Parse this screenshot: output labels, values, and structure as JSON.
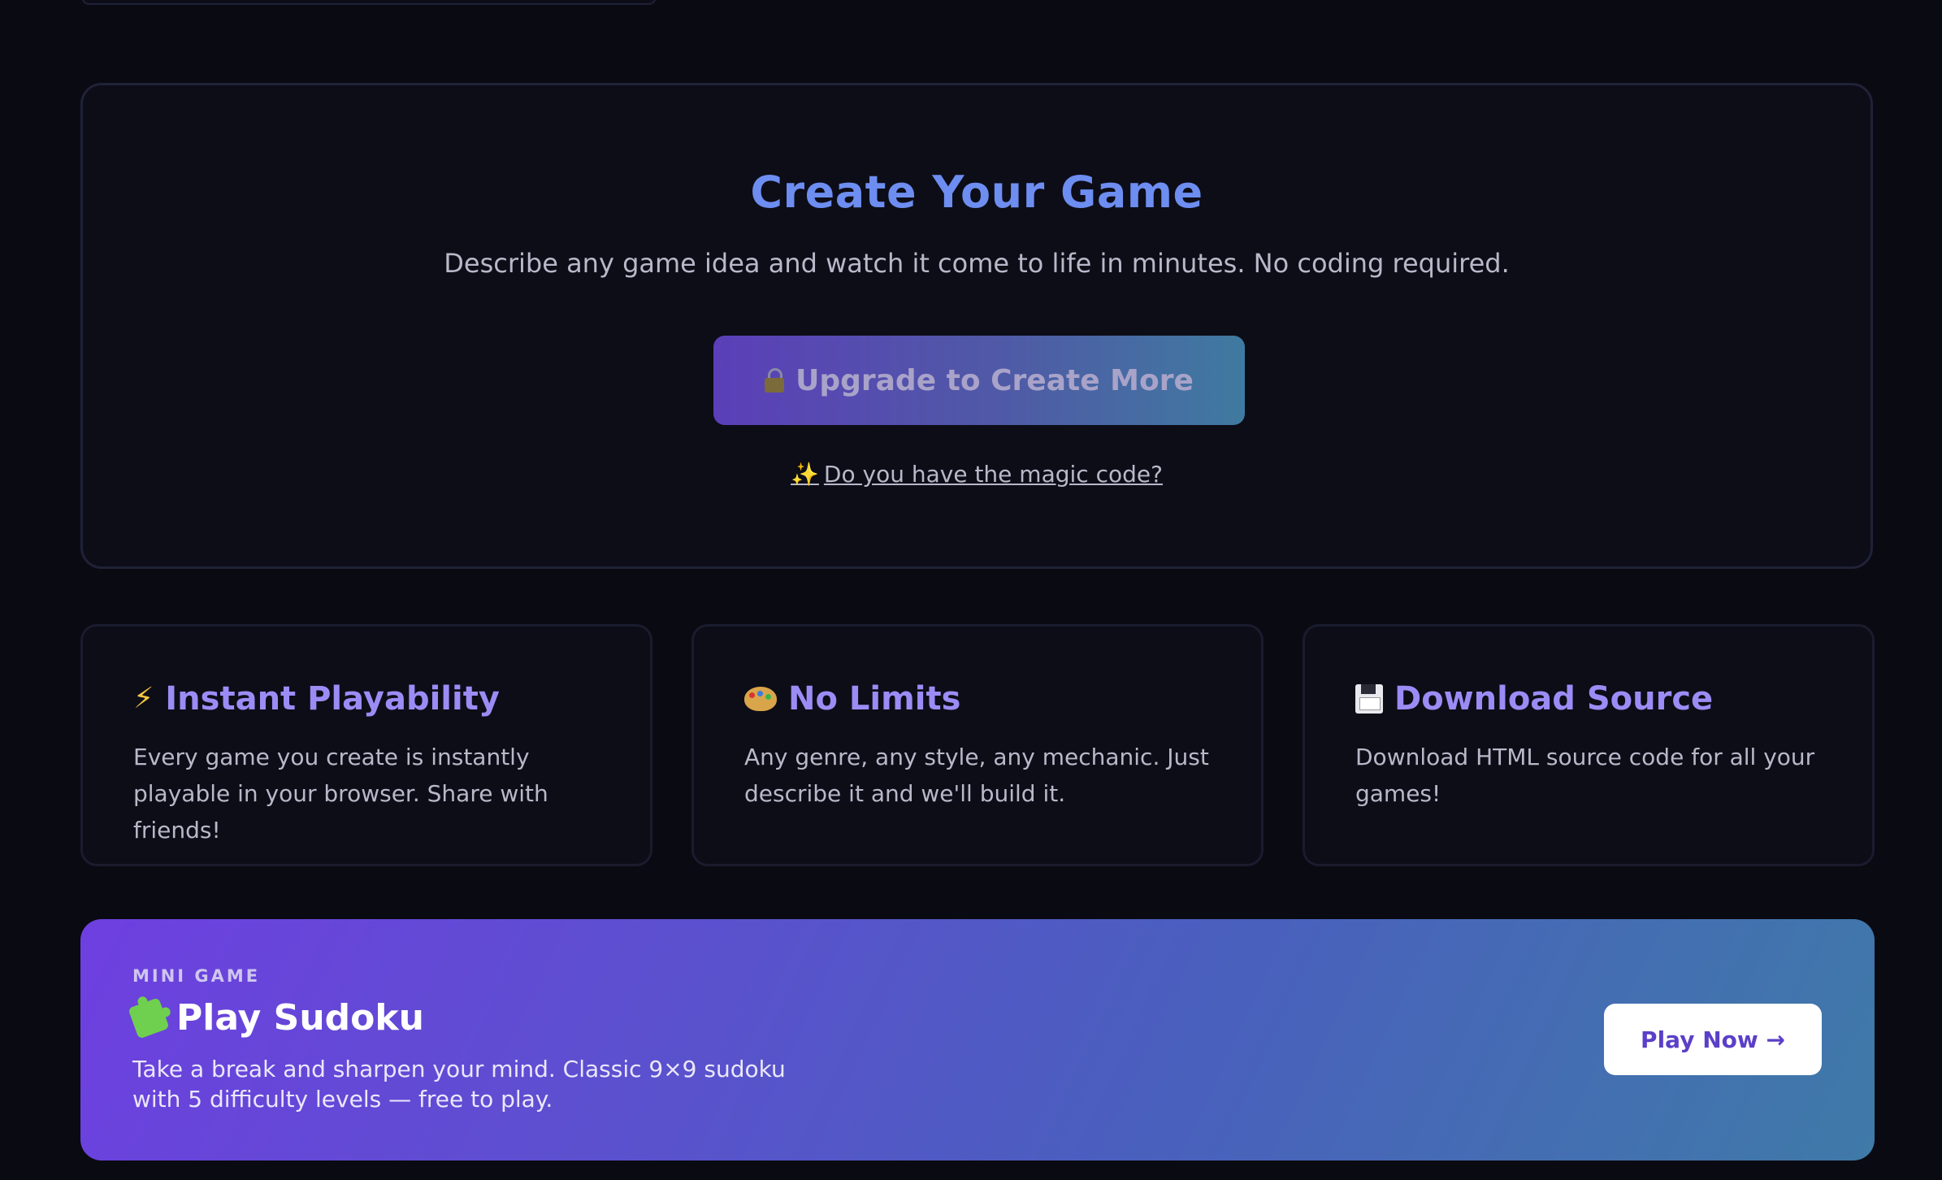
{
  "create": {
    "title": "Create Your Game",
    "subtitle": "Describe any game idea and watch it come to life in minutes. No coding required.",
    "upgrade_label": "Upgrade to Create More",
    "magic_link": "Do you have the magic code?",
    "upgrade_icon": "lock-icon",
    "magic_icon": "sparkles-icon"
  },
  "features": [
    {
      "icon": "lightning-icon",
      "title": "Instant Playability",
      "desc": "Every game you create is instantly playable in your browser. Share with friends!"
    },
    {
      "icon": "palette-icon",
      "title": "No Limits",
      "desc": "Any genre, any style, any mechanic. Just describe it and we'll build it."
    },
    {
      "icon": "floppy-disk-icon",
      "title": "Download Source",
      "desc": "Download HTML source code for all your games!"
    }
  ],
  "mini_game": {
    "tag": "MINI GAME",
    "title": "Play Sudoku",
    "desc": "Take a break and sharpen your mind. Classic 9×9 sudoku with 5 difficulty levels — free to play.",
    "button_label": "Play Now →",
    "icon": "puzzle-piece-icon"
  },
  "colors": {
    "background": "#0a0a12",
    "card": "#0d0d18",
    "title_blue": "#6d8df0",
    "feature_title": "#9b8cf5",
    "banner_start": "#6e3fe0",
    "banner_end": "#3f7aa8"
  }
}
